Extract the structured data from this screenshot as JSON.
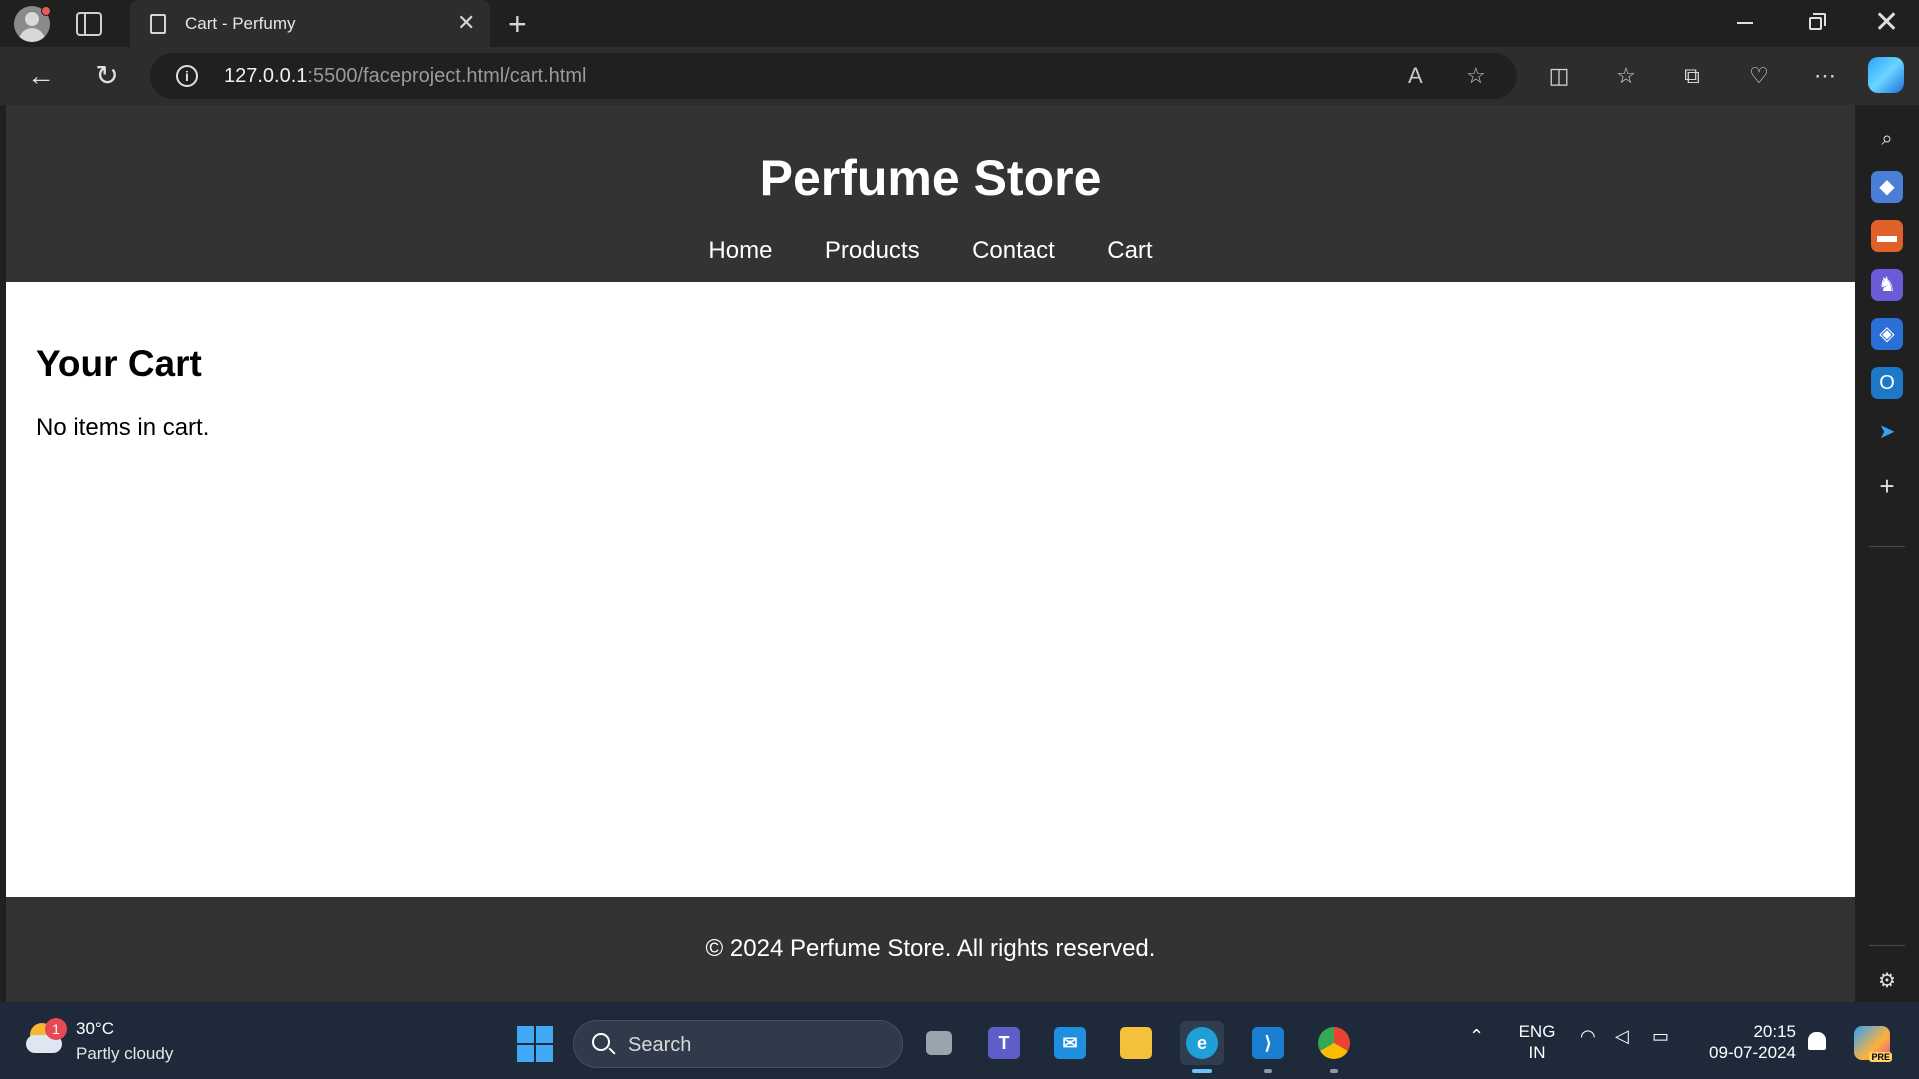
{
  "browser": {
    "tab_title": "Cart - Perfumy",
    "url_host": "127.0.0.1",
    "url_rest": ":5500/faceproject.html/cart.html"
  },
  "site": {
    "title": "Perfume Store",
    "nav": [
      "Home",
      "Products",
      "Contact",
      "Cart"
    ],
    "cart_heading": "Your Cart",
    "cart_empty": "No items in cart.",
    "footer": "© 2024 Perfume Store. All rights reserved."
  },
  "taskbar": {
    "weather_temp": "30°C",
    "weather_desc": "Partly cloudy",
    "weather_badge": "1",
    "search_label": "Search",
    "lang_top": "ENG",
    "lang_bottom": "IN",
    "time": "20:15",
    "date": "09-07-2024",
    "copilot_badge": "PRE"
  },
  "colors": {
    "header_bg": "#333333",
    "accent_blue": "#3fa9f5"
  }
}
